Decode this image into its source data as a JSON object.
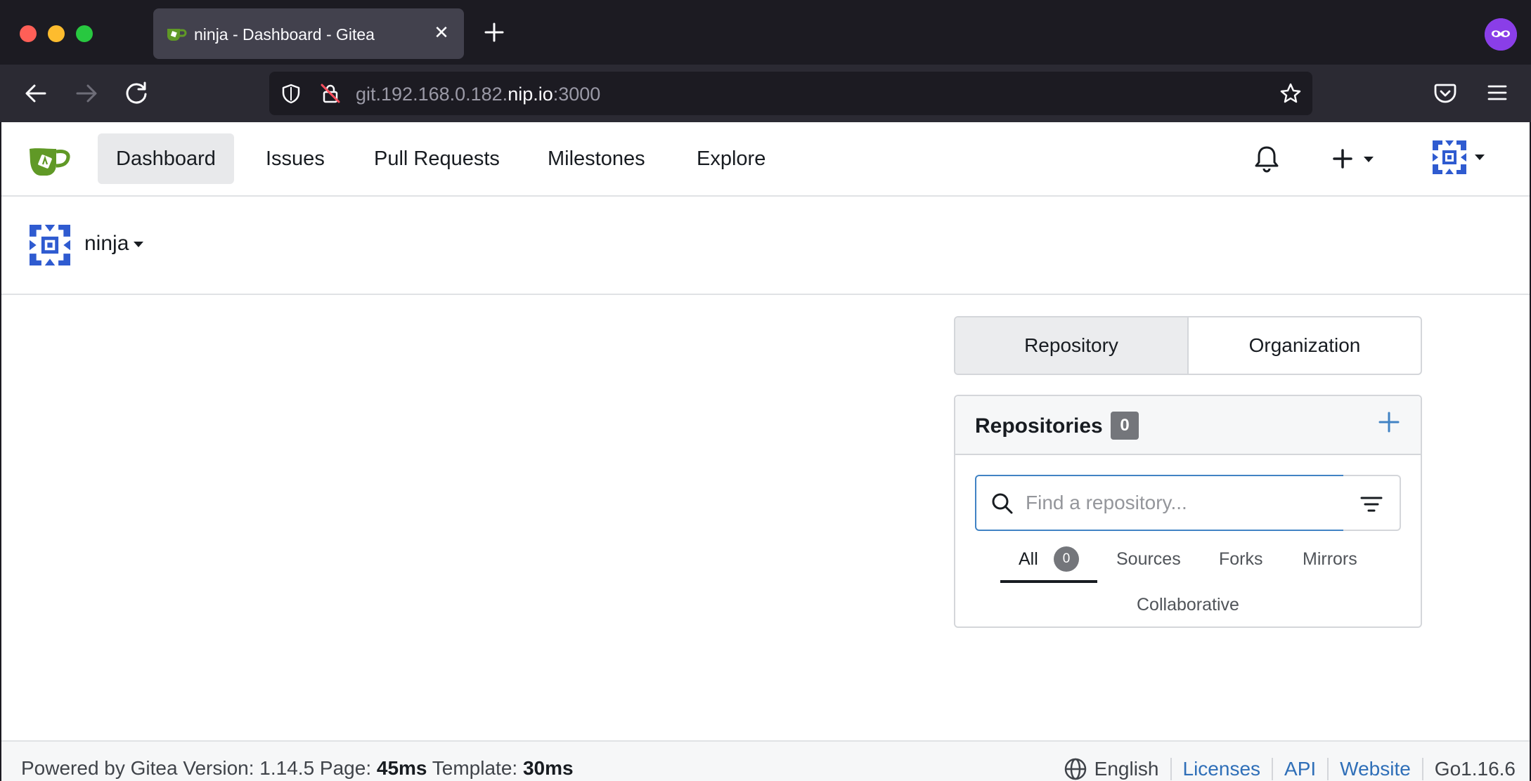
{
  "browser": {
    "tab_title": "ninja - Dashboard - Gitea",
    "url_prefix": "git.192.168.0.182.",
    "url_domain": "nip.io",
    "url_suffix": ":3000"
  },
  "header": {
    "nav": [
      {
        "label": "Dashboard",
        "active": true
      },
      {
        "label": "Issues"
      },
      {
        "label": "Pull Requests"
      },
      {
        "label": "Milestones"
      },
      {
        "label": "Explore"
      }
    ]
  },
  "context": {
    "username": "ninja"
  },
  "switch": {
    "repository": "Repository",
    "organization": "Organization"
  },
  "repos": {
    "title": "Repositories",
    "count": "0",
    "search_placeholder": "Find a repository...",
    "tabs": {
      "all": "All",
      "all_count": "0",
      "sources": "Sources",
      "forks": "Forks",
      "mirrors": "Mirrors",
      "collaborative": "Collaborative"
    }
  },
  "footer": {
    "powered": "Powered by Gitea Version: 1.14.5 Page:",
    "page_time": "45ms",
    "template_label": "Template:",
    "template_time": "30ms",
    "language": "English",
    "licenses": "Licenses",
    "api": "API",
    "website": "Website",
    "go_version": "Go1.16.6"
  },
  "colors": {
    "accent": "#4183c4",
    "gitea_green": "#609926",
    "avatar_blue": "#2f5bd0"
  }
}
